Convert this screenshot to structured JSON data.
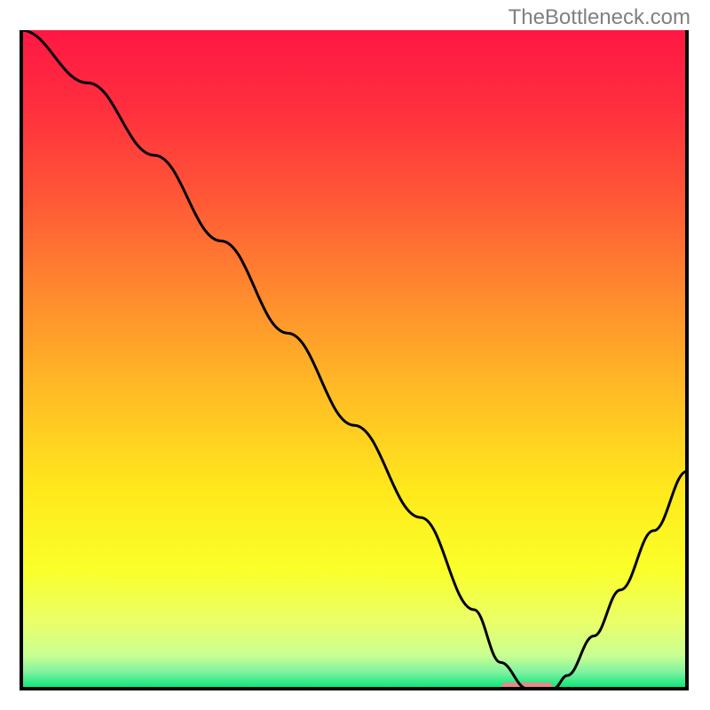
{
  "watermark": "TheBottleneck.com",
  "chart_data": {
    "type": "line",
    "title": "",
    "xlabel": "",
    "ylabel": "",
    "xlim": [
      0,
      100
    ],
    "ylim": [
      0,
      100
    ],
    "gradient_stops": [
      {
        "offset": 0.0,
        "color": "#ff1744"
      },
      {
        "offset": 0.12,
        "color": "#ff2f3e"
      },
      {
        "offset": 0.25,
        "color": "#ff5637"
      },
      {
        "offset": 0.4,
        "color": "#ff8a2e"
      },
      {
        "offset": 0.55,
        "color": "#ffbc25"
      },
      {
        "offset": 0.7,
        "color": "#ffe91c"
      },
      {
        "offset": 0.82,
        "color": "#faff2a"
      },
      {
        "offset": 0.9,
        "color": "#eaff6a"
      },
      {
        "offset": 0.95,
        "color": "#c8ff92"
      },
      {
        "offset": 0.975,
        "color": "#7ff2a0"
      },
      {
        "offset": 1.0,
        "color": "#00e676"
      }
    ],
    "series": [
      {
        "name": "bottleneck-curve",
        "x": [
          0,
          10,
          20,
          30,
          40,
          50,
          60,
          68,
          72,
          76,
          80,
          82,
          86,
          90,
          95,
          100
        ],
        "y": [
          100,
          92,
          81,
          68,
          54,
          40,
          26,
          12,
          4,
          0,
          0,
          2,
          8,
          15,
          24,
          33
        ]
      }
    ],
    "marker": {
      "name": "highlight-segment",
      "x_start": 72,
      "x_end": 80,
      "y": 0,
      "color": "#e98787"
    }
  }
}
